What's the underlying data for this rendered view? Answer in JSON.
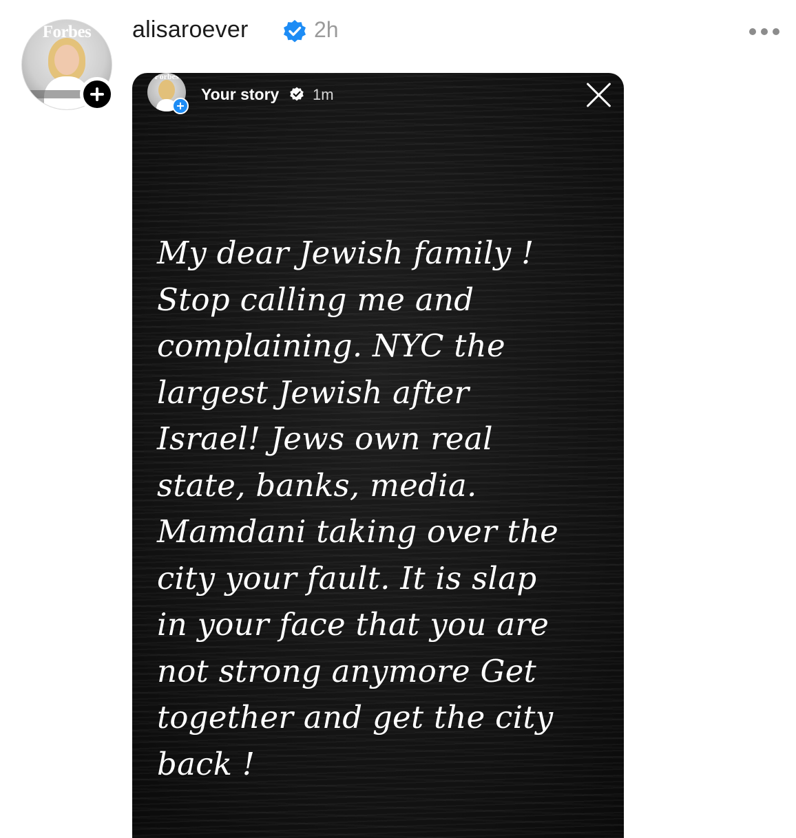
{
  "post": {
    "username": "alisaroever",
    "verified_icon": "verified-badge-icon",
    "time": "2h",
    "avatar_text": "Forbes",
    "more_icon": "more-options-icon",
    "add_icon": "plus-icon"
  },
  "story": {
    "avatar_text": "Forbes",
    "title": "Your story",
    "time": "1m",
    "close_icon": "close-icon",
    "verified_icon": "verified-badge-icon",
    "add_icon": "plus-icon",
    "text_lines": [
      "My dear Jewish family !",
      "Stop calling me and",
      "complaining. NYC the",
      "largest Jewish after",
      "Israel! Jews own real",
      "state, banks, media.",
      "Mamdani taking over the",
      "city your fault. It is slap",
      "in your face that you are",
      "not strong anymore Get",
      "together and get the city",
      "back !"
    ]
  },
  "colors": {
    "verified_blue": "#1d8cf5",
    "story_background": "#141414",
    "story_text": "#ffffff",
    "username_text": "#1b1b1b",
    "muted_text": "#9a9a9a"
  }
}
